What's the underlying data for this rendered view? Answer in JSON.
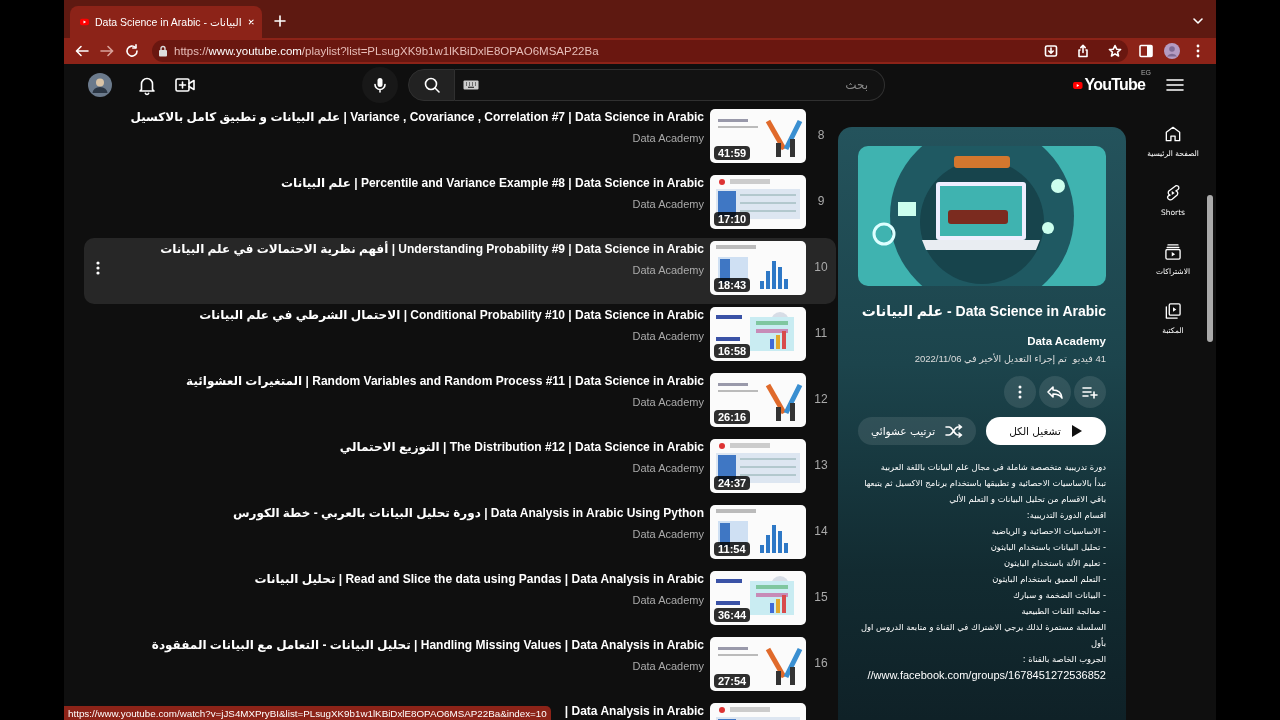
{
  "browser": {
    "tab": {
      "title": "Data Science in Arabic - البيانات",
      "selected": true
    },
    "url": {
      "scheme": "https://",
      "host": "www.youtube.com",
      "path": "/playlist?list=PLsugXK9b1w1lKBiDxlE8OPAO6MSAP22Ba"
    }
  },
  "masthead": {
    "logo_text": "YouTube",
    "country": "EG",
    "search": {
      "placeholder": "بحث"
    }
  },
  "videos": [
    {
      "index": "8",
      "title": "Variance , Covariance , Correlation #7 | Data Science in Arabic | علم البيانات و تطبيق كامل بالاكسيل",
      "channel": "Data Academy",
      "duration": "41:59",
      "hovered": false
    },
    {
      "index": "9",
      "title": "Percentile and Variance Example #8 | Data Science in Arabic | علم البيانات",
      "channel": "Data Academy",
      "duration": "17:10",
      "hovered": false
    },
    {
      "index": "10",
      "title": "Understanding Probability #9 | Data Science in Arabic | أفهم نظرية الاحتمالات في علم البيانات",
      "channel": "Data Academy",
      "duration": "18:43",
      "hovered": true
    },
    {
      "index": "11",
      "title": "Conditional Probability #10 | Data Science in Arabic | الاحتمال الشرطي في علم البيانات",
      "channel": "Data Academy",
      "duration": "16:58",
      "hovered": false
    },
    {
      "index": "12",
      "title": "Random Variables and Random Process #11 | Data Science in Arabic | المتغيرات العشوائية",
      "channel": "Data Academy",
      "duration": "26:16",
      "hovered": false
    },
    {
      "index": "13",
      "title": "The Distribution #12 | Data Science in Arabic | التوزيع الاحتمالي",
      "channel": "Data Academy",
      "duration": "24:37",
      "hovered": false
    },
    {
      "index": "14",
      "title": "Data Analysis in Arabic Using Python | دورة تحليل البيانات بالعربي - خطة الكورس",
      "channel": "Data Academy",
      "duration": "11:54",
      "hovered": false
    },
    {
      "index": "15",
      "title": "Read and Slice the data using Pandas | Data Analysis in Arabic | تحليل البيانات",
      "channel": "Data Academy",
      "duration": "36:44",
      "hovered": false
    },
    {
      "index": "16",
      "title": "Handling Missing Values | Data Analysis in Arabic | تحليل البيانات - التعامل مع البيانات المفقودة",
      "channel": "Data Academy",
      "duration": "27:54",
      "hovered": false
    },
    {
      "title": "Data Analysis in Arabic |",
      "hovered": false
    }
  ],
  "playlist": {
    "title": "Data Science in Arabic - علم البيانات",
    "channel": "Data Academy",
    "videos_count": "41 فيديو",
    "updated": "تم إجراء التعديل الأخير في 2022/11/06",
    "play_all": "تشغيل الكل",
    "shuffle": "ترتيب عشوائي",
    "description": [
      {
        "kind": "text",
        "text": "دورة تدريبية متخصصة شاملة في مجال علم البيانات باللغة العربية"
      },
      {
        "kind": "text",
        "text": "تبدأ بالاساسيات الاحصائية و تطبيقها باستخدام برنامج الاكسيل ثم يتبعها"
      },
      {
        "kind": "text",
        "text": "باقي الاقسام من تحليل البيانات و التعلم الألي"
      },
      {
        "kind": "text",
        "text": "اقسام الدورة التدريبية:"
      },
      {
        "kind": "text",
        "text": "- الاساسيات الاحصائية و الرياضية"
      },
      {
        "kind": "text",
        "text": "- تحليل البيانات باستخدام البايثون"
      },
      {
        "kind": "text",
        "text": "- تعليم الألة باستخدام البايثون"
      },
      {
        "kind": "text",
        "text": "- التعلم العميق باستخدام البايثون"
      },
      {
        "kind": "text",
        "text": "- البيانات الضخمة و سبارك"
      },
      {
        "kind": "text",
        "text": "- معالجة اللغات الطبيعية"
      },
      {
        "kind": "text",
        "text": "السلسلة مستمرة لذلك يرجي الاشتراك في القناة و متابعة الدروس اول"
      },
      {
        "kind": "text",
        "text": "بأول"
      },
      {
        "kind": "text",
        "text": "الجروب الخاصة بالقناة :"
      },
      {
        "kind": "link",
        "text": "//www.facebook.com/groups/1678451272536852"
      }
    ]
  },
  "guide": [
    {
      "kind": "home",
      "label": "الصفحة الرئيسية"
    },
    {
      "kind": "shorts",
      "label": "Shorts"
    },
    {
      "kind": "subscriptions",
      "label": "الاشتراكات"
    },
    {
      "kind": "library",
      "label": "المكتبة"
    }
  ],
  "status_bar": {
    "url": "https://www.youtube.com/watch?v=jJS4MXPryBI&list=PLsugXK9b1w1lKBiDxlE8OPAO6MSAP22Ba&index=10"
  }
}
